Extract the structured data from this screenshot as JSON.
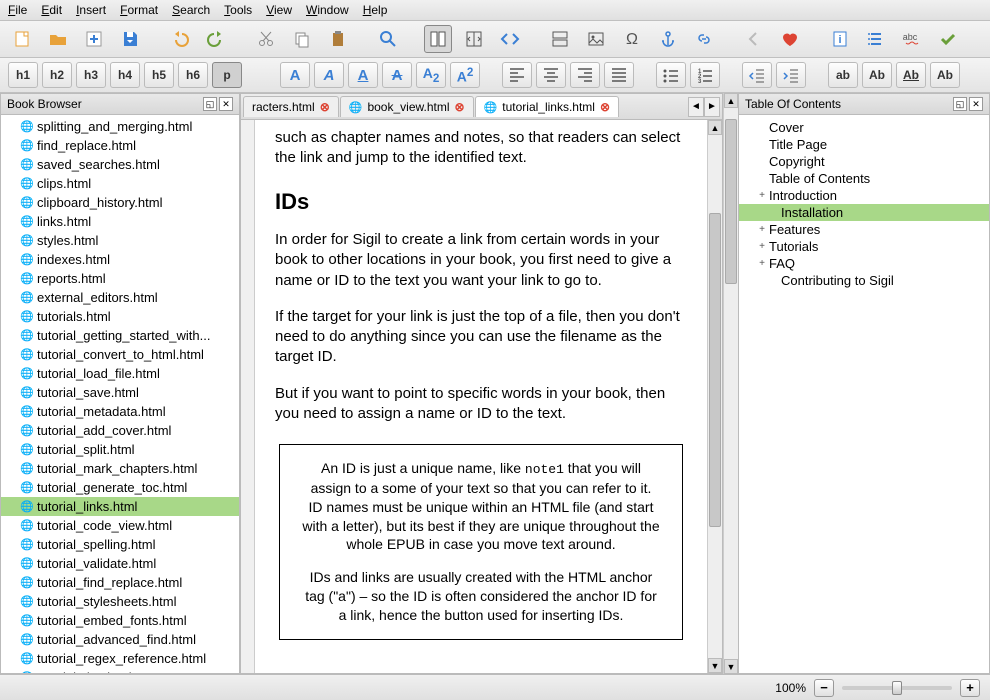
{
  "menu": [
    "File",
    "Edit",
    "Insert",
    "Format",
    "Search",
    "Tools",
    "View",
    "Window",
    "Help"
  ],
  "toolbar1": [
    {
      "name": "new-icon",
      "glyph": "new"
    },
    {
      "name": "open-icon",
      "glyph": "open"
    },
    {
      "name": "add-icon",
      "glyph": "add"
    },
    {
      "name": "save-icon",
      "glyph": "save"
    },
    {
      "sep": true
    },
    {
      "name": "undo-icon",
      "glyph": "undo"
    },
    {
      "name": "redo-icon",
      "glyph": "redo"
    },
    {
      "sep": true
    },
    {
      "name": "cut-icon",
      "glyph": "cut"
    },
    {
      "name": "copy-icon",
      "glyph": "copy"
    },
    {
      "name": "paste-icon",
      "glyph": "paste"
    },
    {
      "sep": true
    },
    {
      "name": "find-icon",
      "glyph": "find"
    },
    {
      "sep": true
    },
    {
      "name": "book-view-icon",
      "glyph": "book",
      "active": true
    },
    {
      "name": "split-view-icon",
      "glyph": "splitv"
    },
    {
      "name": "code-view-icon",
      "glyph": "code"
    },
    {
      "sep": true
    },
    {
      "name": "split-icon",
      "glyph": "split"
    },
    {
      "name": "insert-image-icon",
      "glyph": "image"
    },
    {
      "name": "special-char-icon",
      "glyph": "omega"
    },
    {
      "name": "anchor-icon",
      "glyph": "anchor"
    },
    {
      "name": "link-icon",
      "glyph": "link"
    },
    {
      "sep": true
    },
    {
      "name": "back-icon",
      "glyph": "back"
    },
    {
      "name": "donate-icon",
      "glyph": "heart"
    },
    {
      "sep": true
    },
    {
      "name": "metadata-icon",
      "glyph": "meta"
    },
    {
      "name": "toc-icon",
      "glyph": "toc"
    },
    {
      "name": "spellcheck-icon",
      "glyph": "spell"
    },
    {
      "name": "validate-icon",
      "glyph": "check"
    }
  ],
  "heading_buttons": [
    "h1",
    "h2",
    "h3",
    "h4",
    "h5",
    "h6",
    "p"
  ],
  "toolbar2b": [
    {
      "name": "bold-icon",
      "glyph": "bold"
    },
    {
      "name": "italic-icon",
      "glyph": "italic"
    },
    {
      "name": "underline-icon",
      "glyph": "underline"
    },
    {
      "name": "strike-icon",
      "glyph": "strike"
    },
    {
      "name": "subscript-icon",
      "glyph": "sub"
    },
    {
      "name": "superscript-icon",
      "glyph": "sup"
    },
    {
      "sep": true
    },
    {
      "name": "align-left-icon",
      "glyph": "al"
    },
    {
      "name": "align-center-icon",
      "glyph": "ac"
    },
    {
      "name": "align-right-icon",
      "glyph": "ar"
    },
    {
      "name": "align-justify-icon",
      "glyph": "aj"
    },
    {
      "sep": true
    },
    {
      "name": "list-bullet-icon",
      "glyph": "ul"
    },
    {
      "name": "list-number-icon",
      "glyph": "ol"
    },
    {
      "sep": true
    },
    {
      "name": "outdent-icon",
      "glyph": "outd"
    },
    {
      "name": "indent-icon",
      "glyph": "ind"
    },
    {
      "sep": true
    },
    {
      "name": "case-lower-icon",
      "glyph": "clab"
    },
    {
      "name": "case-title-icon",
      "glyph": "ctAb"
    },
    {
      "name": "case-upper-icon",
      "glyph": "cuAb"
    },
    {
      "name": "case-swap-icon",
      "glyph": "csAb"
    }
  ],
  "left_panel_title": "Book Browser",
  "files": [
    "splitting_and_merging.html",
    "find_replace.html",
    "saved_searches.html",
    "clips.html",
    "clipboard_history.html",
    "links.html",
    "styles.html",
    "indexes.html",
    "reports.html",
    "external_editors.html",
    "tutorials.html",
    "tutorial_getting_started_with...",
    "tutorial_convert_to_html.html",
    "tutorial_load_file.html",
    "tutorial_save.html",
    "tutorial_metadata.html",
    "tutorial_add_cover.html",
    "tutorial_split.html",
    "tutorial_mark_chapters.html",
    "tutorial_generate_toc.html",
    "tutorial_links.html",
    "tutorial_code_view.html",
    "tutorial_spelling.html",
    "tutorial_validate.html",
    "tutorial_find_replace.html",
    "tutorial_stylesheets.html",
    "tutorial_embed_fonts.html",
    "tutorial_advanced_find.html",
    "tutorial_regex_reference.html",
    "tutorial_tips.html"
  ],
  "selected_file": "tutorial_links.html",
  "tabs": [
    {
      "label": "racters.html",
      "full": false
    },
    {
      "label": "book_view.html",
      "full": true
    },
    {
      "label": "tutorial_links.html",
      "full": true,
      "active": true
    }
  ],
  "editor": {
    "p0": "such as chapter names and notes, so that readers can select the link and jump to the identified text.",
    "h": "IDs",
    "p1": "In order for Sigil to create a link from certain words in your book to other locations in your book, you first need to give a name or ID to the text you want your link to go to.",
    "p2": "If the target for your link is just the top of a file, then you don't need to do anything since you can use the filename as the target ID.",
    "p3": "But if you want to point to specific words in your book, then you need to assign a name or ID to the text.",
    "box_pre": "An ID is just a unique name, like ",
    "box_code": "note1",
    "box_post": " that you will assign to a some of your text so that you can refer to it. ID names must be unique within an HTML file (and start with a letter), but its best if they are unique throughout the whole EPUB in case you move text around.",
    "box2": "IDs and links are usually created with the HTML anchor tag (\"a\") – so the ID is often considered the anchor ID for a link, hence the button used for inserting IDs."
  },
  "right_panel_title": "Table Of Contents",
  "toc": [
    {
      "label": "Cover"
    },
    {
      "label": "Title Page"
    },
    {
      "label": "Copyright"
    },
    {
      "label": "Table of Contents"
    },
    {
      "label": "Introduction",
      "exp": "+"
    },
    {
      "label": "Installation",
      "indent": true,
      "selected": true
    },
    {
      "label": "Features",
      "exp": "+"
    },
    {
      "label": "Tutorials",
      "exp": "+"
    },
    {
      "label": "FAQ",
      "exp": "+"
    },
    {
      "label": "Contributing to Sigil",
      "indent": true
    }
  ],
  "zoom_label": "100%"
}
